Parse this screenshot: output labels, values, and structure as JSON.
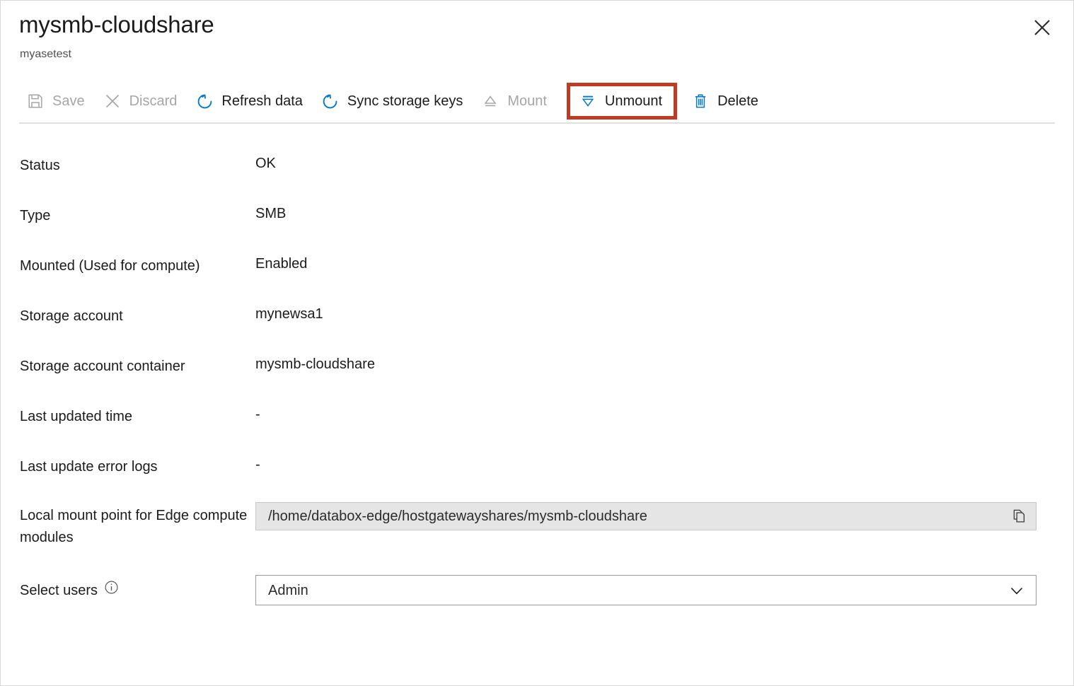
{
  "header": {
    "title": "mysmb-cloudshare",
    "subtitle": "myasetest",
    "close_icon": "close-icon"
  },
  "toolbar": {
    "commands": [
      {
        "id": "save",
        "label": "Save",
        "icon": "save-icon",
        "enabled": false,
        "highlighted": false
      },
      {
        "id": "discard",
        "label": "Discard",
        "icon": "close-icon",
        "enabled": false,
        "highlighted": false
      },
      {
        "id": "refresh",
        "label": "Refresh data",
        "icon": "refresh-icon",
        "enabled": true,
        "highlighted": false
      },
      {
        "id": "sync-keys",
        "label": "Sync storage keys",
        "icon": "refresh-icon",
        "enabled": true,
        "highlighted": false
      },
      {
        "id": "mount",
        "label": "Mount",
        "icon": "eject-up-icon",
        "enabled": false,
        "highlighted": false
      },
      {
        "id": "unmount",
        "label": "Unmount",
        "icon": "eject-down-icon",
        "enabled": true,
        "highlighted": true
      },
      {
        "id": "delete",
        "label": "Delete",
        "icon": "trash-icon",
        "enabled": true,
        "highlighted": false
      }
    ]
  },
  "properties": {
    "status": {
      "label": "Status",
      "value": "OK"
    },
    "type": {
      "label": "Type",
      "value": "SMB"
    },
    "mounted": {
      "label": "Mounted (Used for compute)",
      "value": "Enabled"
    },
    "storage_account": {
      "label": "Storage account",
      "value": "mynewsa1"
    },
    "storage_container": {
      "label": "Storage account container",
      "value": "mysmb-cloudshare"
    },
    "last_updated_time": {
      "label": "Last updated time",
      "value": "-"
    },
    "last_update_errors": {
      "label": "Last update error logs",
      "value": "-"
    },
    "mount_point": {
      "label": "Local mount point for Edge compute modules",
      "value": "/home/databox-edge/hostgatewayshares/mysmb-cloudshare",
      "copy_icon": "copy-icon"
    },
    "select_users": {
      "label": "Select users",
      "info_icon": "info-icon",
      "value": "Admin",
      "chevron_icon": "chevron-down-icon",
      "options": [
        "Admin"
      ]
    }
  },
  "colors": {
    "accent_blue": "#0078d4",
    "highlight_red": "#c13b23",
    "disabled_gray": "#a6a6a6",
    "text": "#1b1b1b",
    "field_readonly_bg": "#e5e5e5"
  }
}
